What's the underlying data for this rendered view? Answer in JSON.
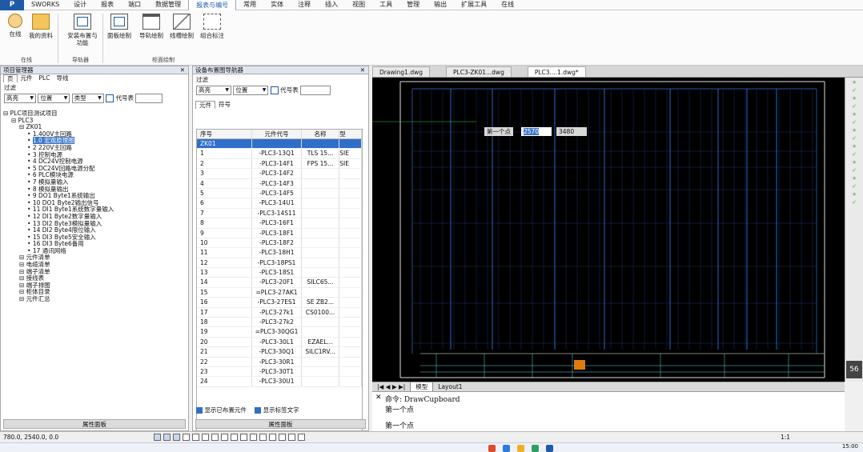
{
  "ribbon_tabs": [
    "SWORKS",
    "设计",
    "报表",
    "端口",
    "数据管理",
    "报表与编号",
    "常用",
    "实体",
    "注释",
    "插入",
    "视图",
    "工具",
    "管理",
    "输出",
    "扩展工具",
    "在线"
  ],
  "ribbon_active_tab": "报表与编号",
  "ribbon_buttons": [
    {
      "label": "在线",
      "icon": "user-icon"
    },
    {
      "label": "我的资料",
      "icon": "folder-icon"
    },
    {
      "label": "安装布置与功能",
      "icon": "cabinet-icon"
    },
    {
      "label": "面板绘制",
      "icon": "panel-draw-icon"
    },
    {
      "label": "导轨绘制",
      "icon": "rail-draw-icon"
    },
    {
      "label": "线槽绘制",
      "icon": "duct-draw-icon"
    },
    {
      "label": "组合标注",
      "icon": "annotate-icon"
    }
  ],
  "ribbon_groups": [
    "在线",
    "导轨器",
    "柜面绘制"
  ],
  "project_panel": {
    "title": "项目管理器",
    "tabs": [
      "页",
      "元件",
      "PLC",
      "导线"
    ],
    "filter_label": "过滤",
    "filter_values": [
      "高亮",
      "位置",
      "类型"
    ],
    "codes_label": "代号表",
    "tree": [
      {
        "level": 0,
        "text": "PLC项目测试项目"
      },
      {
        "level": 1,
        "text": "PLC3"
      },
      {
        "level": 2,
        "text": "ZK01"
      },
      {
        "level": 3,
        "text": "1.400V主回路"
      },
      {
        "level": 3,
        "text": "1.0 宏观原理图",
        "selected": true
      },
      {
        "level": 3,
        "text": "2 220V主回路"
      },
      {
        "level": 3,
        "text": "3 控制电源"
      },
      {
        "level": 3,
        "text": "4 DC24V控制电源"
      },
      {
        "level": 3,
        "text": "5 DC24V回路电源分配"
      },
      {
        "level": 3,
        "text": "6 PLC模块电源"
      },
      {
        "level": 3,
        "text": "7 模拟量输入"
      },
      {
        "level": 3,
        "text": "8 模拟量输出"
      },
      {
        "level": 3,
        "text": "9 DO1 Byte1系统输出"
      },
      {
        "level": 3,
        "text": "10 DO1 Byte2输出信号"
      },
      {
        "level": 3,
        "text": "11 DI1 Byte1系统数字量输入"
      },
      {
        "level": 3,
        "text": "12 DI1 Byte2数字量输入"
      },
      {
        "level": 3,
        "text": "13 DI2 Byte3模拟量输入"
      },
      {
        "level": 3,
        "text": "14 DI2 Byte4限位输入"
      },
      {
        "level": 3,
        "text": "15 DI3 Byte5安全输入"
      },
      {
        "level": 3,
        "text": "16 DI3 Byte6备用"
      },
      {
        "level": 3,
        "text": "17 通讯网络"
      },
      {
        "level": 2,
        "text": "元件清单"
      },
      {
        "level": 2,
        "text": "电缆清单"
      },
      {
        "level": 2,
        "text": "端子清单"
      },
      {
        "level": 2,
        "text": "接线表"
      },
      {
        "level": 2,
        "text": "端子排图"
      },
      {
        "level": 2,
        "text": "柜体目录"
      },
      {
        "level": 2,
        "text": "元件汇总"
      }
    ],
    "footer": "属性面板"
  },
  "component_panel": {
    "title": "设备布置图导航器",
    "filter_label": "过滤",
    "filter_values": [
      "高亮",
      "位置"
    ],
    "codes_label": "代号表",
    "tabs": [
      "元件",
      "符号"
    ],
    "columns": [
      "序号",
      "元件代号",
      "名称",
      "型"
    ],
    "rows": [
      {
        "no": "ZK01",
        "code": "",
        "name": "",
        "type": "",
        "selected": true
      },
      {
        "no": "1",
        "code": "-PLC3-13Q1",
        "name": "TLS 15...",
        "type": "SIE"
      },
      {
        "no": "2",
        "code": "-PLC3-14F1",
        "name": "FPS 15...",
        "type": "SIE"
      },
      {
        "no": "3",
        "code": "-PLC3-14F2",
        "name": "",
        "type": ""
      },
      {
        "no": "4",
        "code": "-PLC3-14F3",
        "name": "",
        "type": ""
      },
      {
        "no": "5",
        "code": "-PLC3-14F5",
        "name": "",
        "type": ""
      },
      {
        "no": "6",
        "code": "-PLC3-14U1",
        "name": "",
        "type": ""
      },
      {
        "no": "7",
        "code": "-PLC3-14S11",
        "name": "",
        "type": ""
      },
      {
        "no": "8",
        "code": "-PLC3-16F1",
        "name": "",
        "type": ""
      },
      {
        "no": "9",
        "code": "-PLC3-18F1",
        "name": "",
        "type": ""
      },
      {
        "no": "10",
        "code": "-PLC3-18F2",
        "name": "",
        "type": ""
      },
      {
        "no": "11",
        "code": "-PLC3-18H1",
        "name": "",
        "type": ""
      },
      {
        "no": "12",
        "code": "-PLC3-18PS1",
        "name": "",
        "type": ""
      },
      {
        "no": "13",
        "code": "-PLC3-18S1",
        "name": "",
        "type": ""
      },
      {
        "no": "14",
        "code": "-PLC3-20F1",
        "name": "SILC65...",
        "type": ""
      },
      {
        "no": "15",
        "code": "=PLC3-27AK1",
        "name": "",
        "type": ""
      },
      {
        "no": "16",
        "code": "-PLC3-27ES1",
        "name": "SE ZB2...",
        "type": ""
      },
      {
        "no": "17",
        "code": "-PLC3-27k1",
        "name": "CS0100...",
        "type": ""
      },
      {
        "no": "18",
        "code": "-PLC3-27k2",
        "name": "",
        "type": ""
      },
      {
        "no": "19",
        "code": "=PLC3-30QG1",
        "name": "",
        "type": ""
      },
      {
        "no": "20",
        "code": "-PLC3-30L1",
        "name": "EZAEL...",
        "type": ""
      },
      {
        "no": "21",
        "code": "-PLC3-30Q1",
        "name": "SILC1RV...",
        "type": ""
      },
      {
        "no": "22",
        "code": "-PLC3-30R1",
        "name": "",
        "type": ""
      },
      {
        "no": "23",
        "code": "-PLC3-30T1",
        "name": "",
        "type": ""
      },
      {
        "no": "24",
        "code": "-PLC3-30U1",
        "name": "",
        "type": ""
      }
    ],
    "checkbox_1": "显示已布置元件",
    "checkbox_2": "显示标签文字",
    "footer": "属性面板"
  },
  "cad_tabs": [
    "Drawing1.dwg",
    "PLC3-ZK01...dwg",
    "PLC3....1.dwg*"
  ],
  "cad_active_tab": "PLC3....1.dwg*",
  "cad_prompt": {
    "label": "第一个点",
    "x": "2570",
    "y": "3480"
  },
  "layout_tabs": [
    "模型",
    "Layout1"
  ],
  "command_lines": [
    "命令:  DrawCupboard",
    "第一个点",
    "第一个点"
  ],
  "status_coords": "780.0, 2540.0, 0.0",
  "status_scale": "1:1",
  "taskbar_time": "15:00",
  "clock_side": "56",
  "colors": {
    "accent": "#1e5aa8",
    "selection": "#2f6fc8",
    "cad_bg": "#000000",
    "cad_line": "#2a74d8",
    "cad_text": "#55e0e0",
    "logo_orange": "#e07a10"
  }
}
